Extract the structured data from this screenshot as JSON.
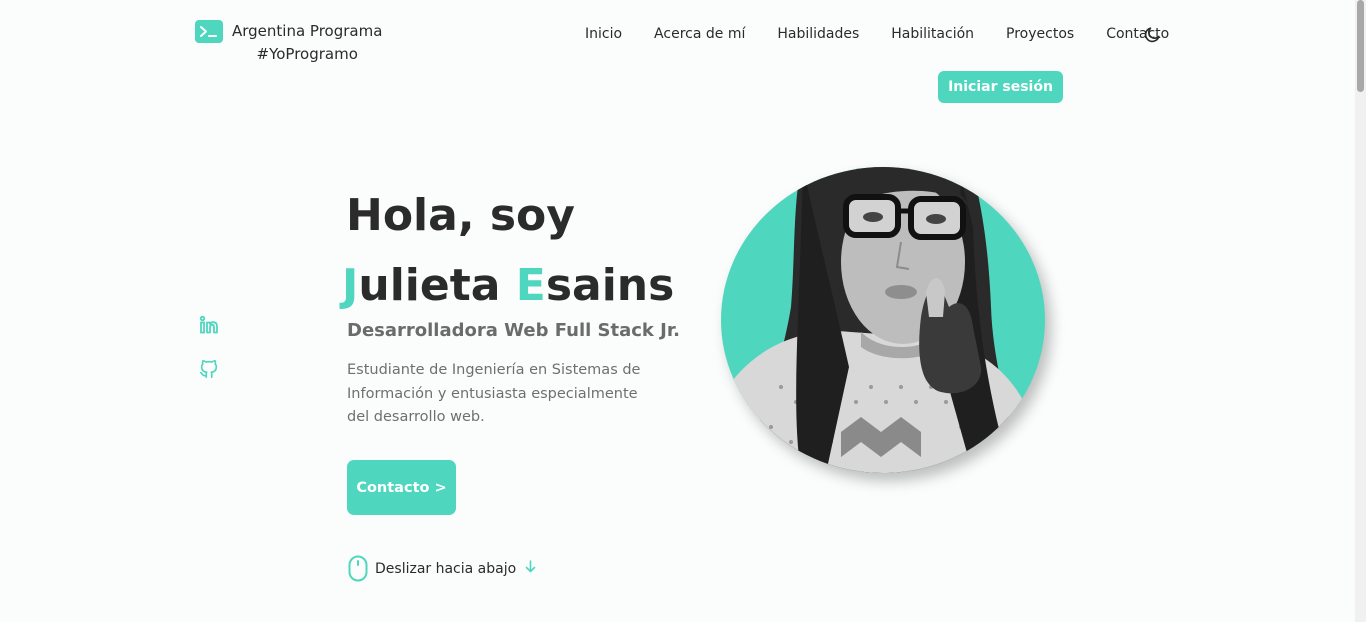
{
  "header": {
    "logo_line1": "Argentina Programa",
    "logo_line2": "#YoProgramo",
    "logo_icon": "terminal-icon",
    "nav": [
      "Inicio",
      "Acerca de mí",
      "Habilidades",
      "Habilitación",
      "Proyectos",
      "Contacto"
    ],
    "theme_icon": "moon-icon",
    "login_label": "Iniciar sesión"
  },
  "social": {
    "icons": [
      "linkedin-icon",
      "github-icon"
    ]
  },
  "hero": {
    "greeting": "Hola, soy",
    "first_initial": "J",
    "first_rest": "ulieta",
    "last_initial": "E",
    "last_rest": "sains",
    "subtitle": "Desarrolladora Web Full Stack Jr.",
    "description": "Estudiante de Ingeniería en Sistemas de Información y entusiasta especialmente del desarrollo web.",
    "contact_label": "Contacto >",
    "scroll_label": "Deslizar hacia abajo"
  },
  "colors": {
    "accent": "#4fd6be",
    "text": "#2b2b2b",
    "muted": "#6f6f6f",
    "background": "#fbfdfc"
  }
}
